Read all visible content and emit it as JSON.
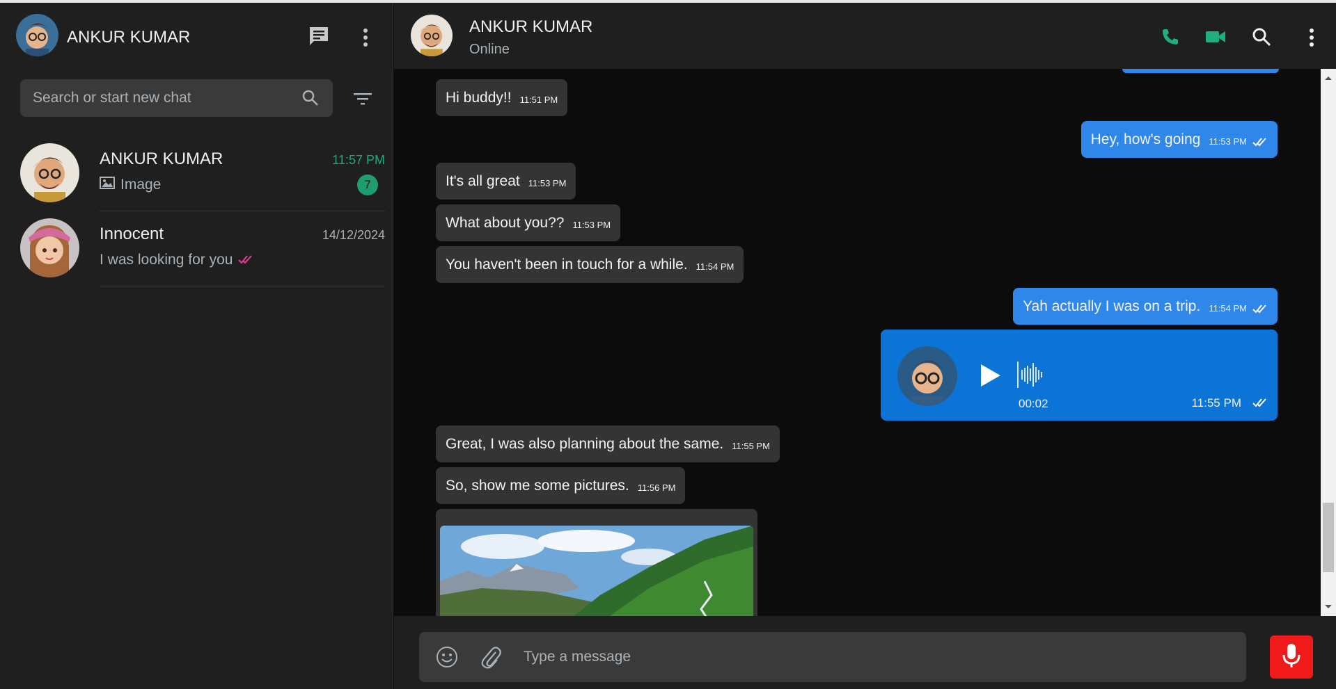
{
  "sidebar": {
    "user_name": "ANKUR KUMAR",
    "search_placeholder": "Search or start new chat",
    "chats": [
      {
        "name": "ANKUR KUMAR",
        "time": "11:57 PM",
        "preview": "Image",
        "unread": "7"
      },
      {
        "name": "Innocent",
        "time": "14/12/2024",
        "preview": "I was looking for you"
      }
    ]
  },
  "header": {
    "name": "ANKUR KUMAR",
    "status": "Online"
  },
  "messages": [
    {
      "text": "Hi buddy!!",
      "time": "11:51 PM",
      "dir": "in"
    },
    {
      "text": "Hey, how's going",
      "time": "11:53 PM",
      "dir": "out"
    },
    {
      "text": "It's all great",
      "time": "11:53 PM",
      "dir": "in"
    },
    {
      "text": "What about you??",
      "time": "11:53 PM",
      "dir": "in"
    },
    {
      "text": "You haven't been in touch for a while.",
      "time": "11:54 PM",
      "dir": "in"
    },
    {
      "text": "Yah actually I was on a trip.",
      "time": "11:54 PM",
      "dir": "out"
    },
    {
      "text": "Great, I was also planning about the same.",
      "time": "11:55 PM",
      "dir": "in"
    },
    {
      "text": "So, show me some pictures.",
      "time": "11:56 PM",
      "dir": "in"
    }
  ],
  "voice_message": {
    "duration": "00:02",
    "time": "11:55 PM"
  },
  "composer": {
    "placeholder": "Type a message"
  },
  "colors": {
    "accent_green": "#25a77a",
    "outgoing_bubble": "#2f88e9",
    "voice_bubble": "#0b74d6",
    "mic_red": "#f01a1a",
    "read_tick_pink": "#e0409a"
  }
}
